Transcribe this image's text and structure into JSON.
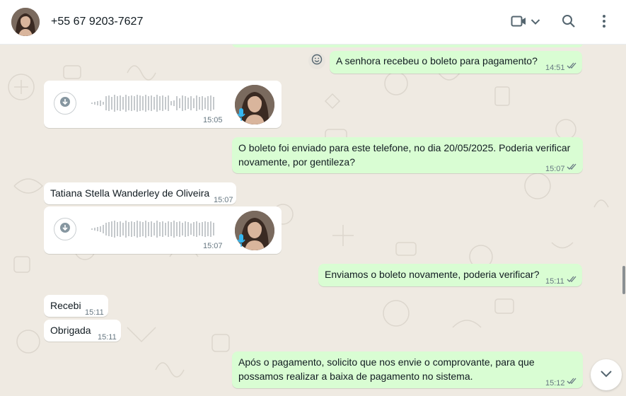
{
  "header": {
    "contact_name": "+55 67 9203-7627",
    "icons": [
      "video-call-icon",
      "chevron-down-icon",
      "search-icon",
      "menu-icon"
    ]
  },
  "messages": [
    {
      "type": "text",
      "direction": "out",
      "text": "A senhora recebeu o boleto para pagamento?",
      "time": "14:51",
      "status": "read"
    },
    {
      "type": "audio",
      "direction": "in",
      "time": "15:05"
    },
    {
      "type": "text",
      "direction": "out",
      "text_line1": "O boleto foi enviado para este telefone, no dia 20/05/2025. Poderia verificar",
      "text_line2": "novamente, por gentileza?",
      "time": "15:07",
      "status": "read"
    },
    {
      "type": "text",
      "direction": "in",
      "text": "Tatiana Stella Wanderley de Oliveira",
      "time": "15:07"
    },
    {
      "type": "audio",
      "direction": "in",
      "time": "15:07"
    },
    {
      "type": "text",
      "direction": "out",
      "text": "Enviamos o boleto novamente, poderia verificar?",
      "time": "15:11",
      "status": "read"
    },
    {
      "type": "text",
      "direction": "in",
      "text": "Recebi",
      "time": "15:11"
    },
    {
      "type": "text",
      "direction": "in",
      "text": "Obrigada",
      "time": "15:11"
    },
    {
      "type": "text",
      "direction": "out",
      "text_line1": "Após o pagamento, solicito que nos envie o comprovante, para que",
      "text_line2": "possamos realizar a baixa de pagamento no sistema.",
      "time": "15:12",
      "status": "read"
    }
  ],
  "colors": {
    "outgoing": "#d9fdd3",
    "incoming": "#ffffff",
    "background": "#efeae2",
    "read_ticks": "#53bdeb"
  }
}
